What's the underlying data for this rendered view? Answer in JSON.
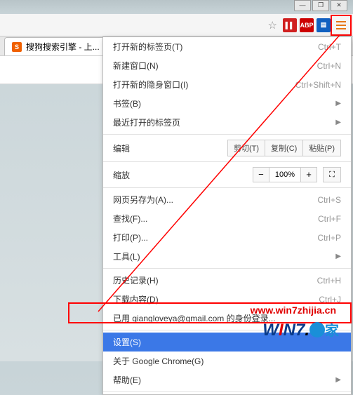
{
  "window": {
    "min": "—",
    "max": "❐",
    "close": "✕"
  },
  "toolbar": {
    "star": "☆",
    "ext1": "▌▌",
    "ext2": "ABP",
    "ext3": "▤"
  },
  "tab": {
    "favicon": "S",
    "title": "搜狗搜索引擎 - 上..."
  },
  "menu": {
    "new_tab": "打开新的标签页(T)",
    "new_tab_sc": "Ctrl+T",
    "new_window": "新建窗口(N)",
    "new_window_sc": "Ctrl+N",
    "incognito": "打开新的隐身窗口(I)",
    "incognito_sc": "Ctrl+Shift+N",
    "bookmarks": "书签(B)",
    "recent": "最近打开的标签页",
    "edit_label": "编辑",
    "cut": "剪切(T)",
    "copy": "复制(C)",
    "paste": "粘贴(P)",
    "zoom_label": "缩放",
    "zoom_minus": "−",
    "zoom_value": "100%",
    "zoom_plus": "+",
    "fullscreen": "⛶",
    "save_as": "网页另存为(A)...",
    "save_as_sc": "Ctrl+S",
    "find": "查找(F)...",
    "find_sc": "Ctrl+F",
    "print": "打印(P)...",
    "print_sc": "Ctrl+P",
    "tools": "工具(L)",
    "history": "历史记录(H)",
    "history_sc": "Ctrl+H",
    "downloads": "下载内容(D)",
    "downloads_sc": "Ctrl+J",
    "signed_in": "已用 qiangloveya@gmail.com 的身份登录...",
    "settings": "设置(S)",
    "about": "关于 Google Chrome(G)",
    "help": "帮助(E)"
  },
  "watermark": {
    "url": "www.win7zhijia.cn",
    "w": "W",
    "i": "I",
    "n": "N",
    "seven": "7",
    "jia": "家"
  }
}
